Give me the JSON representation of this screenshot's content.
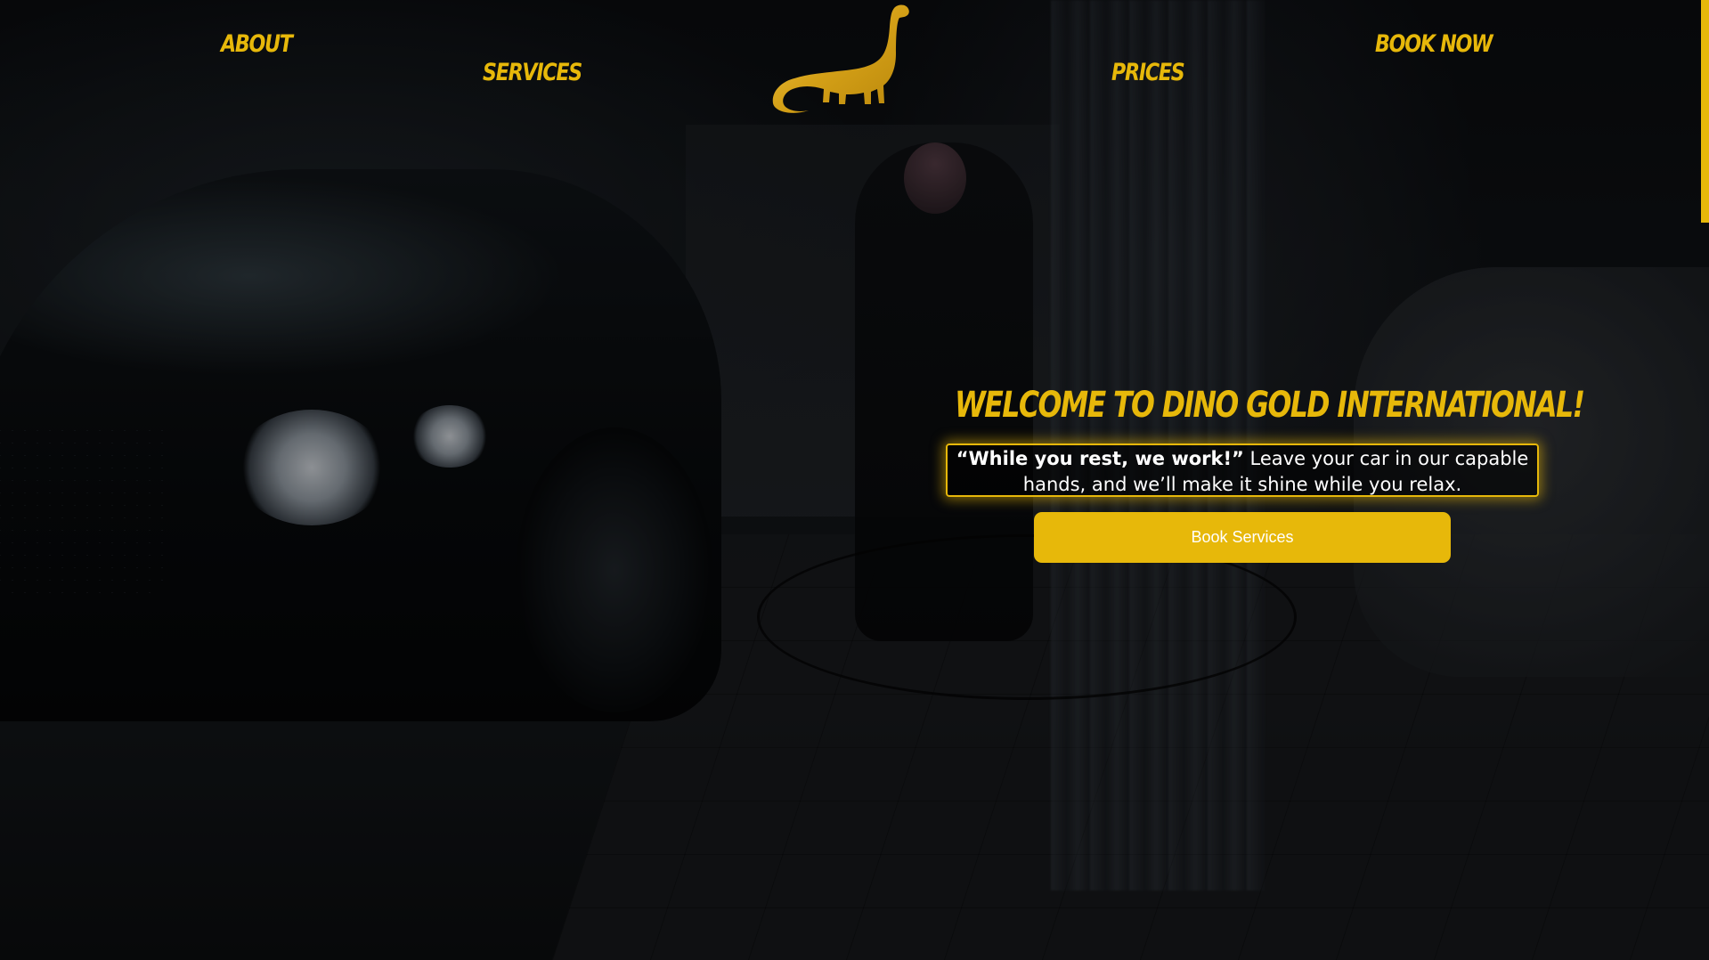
{
  "nav": {
    "about": "About",
    "services": "Services",
    "prices": "Prices",
    "book_now": "Book Now"
  },
  "logo": {
    "icon": "dinosaur-icon"
  },
  "hero": {
    "title": "Welcome to Dino Gold International!",
    "tagline_bold": "“While you rest, we work!”",
    "tagline_rest": " Leave your car in our capable hands, and we’ll make it shine while you relax.",
    "cta_label": "Book Services"
  },
  "colors": {
    "accent": "#e7b80a",
    "text": "#ffffff",
    "background": "#0b0d10"
  }
}
